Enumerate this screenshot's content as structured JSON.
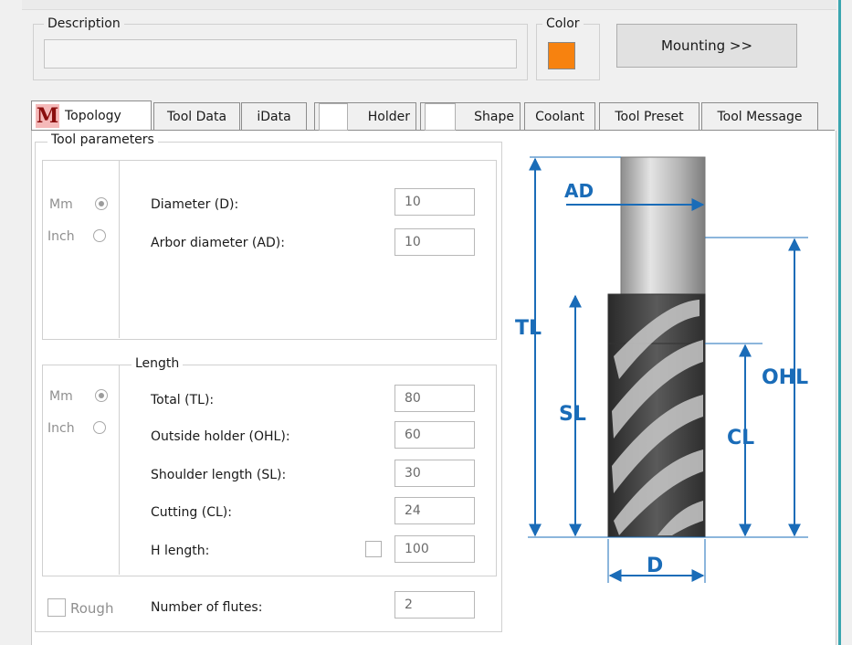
{
  "header": {
    "description_label": "Description",
    "description_value": "",
    "color_label": "Color",
    "color_swatch": "#f7820f",
    "mounting_button": "Mounting >>"
  },
  "tabs": [
    {
      "label": "Topology"
    },
    {
      "label": "Tool Data"
    },
    {
      "label": "iData"
    },
    {
      "label": "Holder"
    },
    {
      "label": "Shape"
    },
    {
      "label": "Coolant"
    },
    {
      "label": "Tool Preset"
    },
    {
      "label": "Tool Message"
    }
  ],
  "tool_parameters": {
    "title": "Tool parameters",
    "units": {
      "mm": "Mm",
      "inch": "Inch"
    },
    "diameter_label": "Diameter (D):",
    "diameter_value": "10",
    "arbor_label": "Arbor diameter (AD):",
    "arbor_value": "10"
  },
  "length": {
    "title": "Length",
    "units": {
      "mm": "Mm",
      "inch": "Inch"
    },
    "total_label": "Total (TL):",
    "total_value": "80",
    "ohl_label": "Outside holder (OHL):",
    "ohl_value": "60",
    "sl_label": "Shoulder length (SL):",
    "sl_value": "30",
    "cl_label": "Cutting (CL):",
    "cl_value": "24",
    "h_label": "H length:",
    "h_value": "100"
  },
  "flutes": {
    "rough_label": "Rough",
    "label": "Number of flutes:",
    "value": "2"
  },
  "diagram": {
    "ad": "AD",
    "tl": "TL",
    "sl": "SL",
    "ohl": "OHL",
    "cl": "CL",
    "d": "D"
  }
}
